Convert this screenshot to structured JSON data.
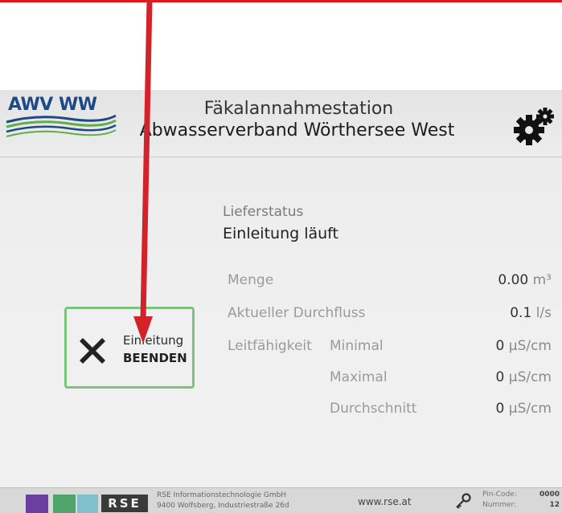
{
  "colors": {
    "annotation_arrow": "#d2232a",
    "button_border": "#7cc47c",
    "logo_blue": "#1d4a86",
    "logo_green": "#5fae4a"
  },
  "header": {
    "logo_text": "AWV WW",
    "title_line1": "Fäkalannahmestation",
    "title_line2": "Abwasserverband Wörthersee West",
    "settings_icon": "gear-icon"
  },
  "abort_button": {
    "line1": "Einleitung",
    "line2": "BEENDEN",
    "icon": "close-icon"
  },
  "status": {
    "label": "Lieferstatus",
    "value": "Einleitung läuft"
  },
  "measurements": {
    "menge": {
      "label": "Menge",
      "value": "0.00",
      "unit": "m³"
    },
    "durchfluss": {
      "label": "Aktueller Durchfluss",
      "value": "0.1",
      "unit": "l/s"
    },
    "leitfaehigkeit": {
      "label": "Leitfähigkeit",
      "minimal": {
        "label": "Minimal",
        "value": "0",
        "unit": "µS/cm"
      },
      "maximal": {
        "label": "Maximal",
        "value": "0",
        "unit": "µS/cm"
      },
      "durchschnitt": {
        "label": "Durchschnitt",
        "value": "0",
        "unit": "µS/cm"
      }
    }
  },
  "footer": {
    "swatches": [
      "#6a3fa0",
      "#4fa46a",
      "#7fc0ca"
    ],
    "brand": "RSE",
    "company_line1": "RSE Informationstechnologie GmbH",
    "company_line2": "9400 Wolfsberg, Industriestraße 26d",
    "website": "www.rse.at",
    "pin_label": "Pin-Code:",
    "pin_value": "0000",
    "number_label": "Nummer:",
    "number_value": "12"
  }
}
